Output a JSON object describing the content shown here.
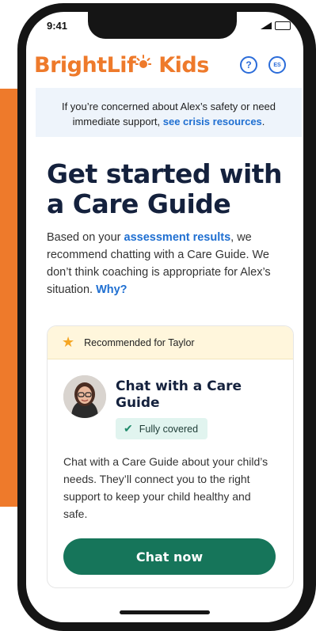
{
  "statusbar": {
    "time": "9:41"
  },
  "header": {
    "logo_part1": "BrightLif",
    "logo_part2": " Kids",
    "help_icon_glyph": "?",
    "language_label": "ES"
  },
  "crisis_banner": {
    "text": "If you’re concerned about Alex’s safety or need immediate support, ",
    "link_text": "see crisis resources",
    "suffix": "."
  },
  "main": {
    "title": "Get started with a Care Guide",
    "intro_before": "Based on your ",
    "intro_link": "assessment results",
    "intro_after": ", we recommend chatting with a Care Guide. We don’t think coaching is appropriate for Alex’s situation. ",
    "why_link": "Why?"
  },
  "card": {
    "tag_label": "Recommended for Taylor",
    "title": "Chat with a Care Guide",
    "badge_label": "Fully covered",
    "description": "Chat with a Care Guide about your child’s needs. They’ll connect you to the right support to keep your child healthy and safe.",
    "cta_label": "Chat now"
  },
  "colors": {
    "brand_orange": "#ee7a2b",
    "link_blue": "#1f6fd1",
    "cta_green": "#16755a",
    "banner_bg": "#eef4fb"
  },
  "icons": {
    "star": "star-icon",
    "badge": "double-check-icon",
    "help": "question-icon",
    "language": "language-icon"
  }
}
